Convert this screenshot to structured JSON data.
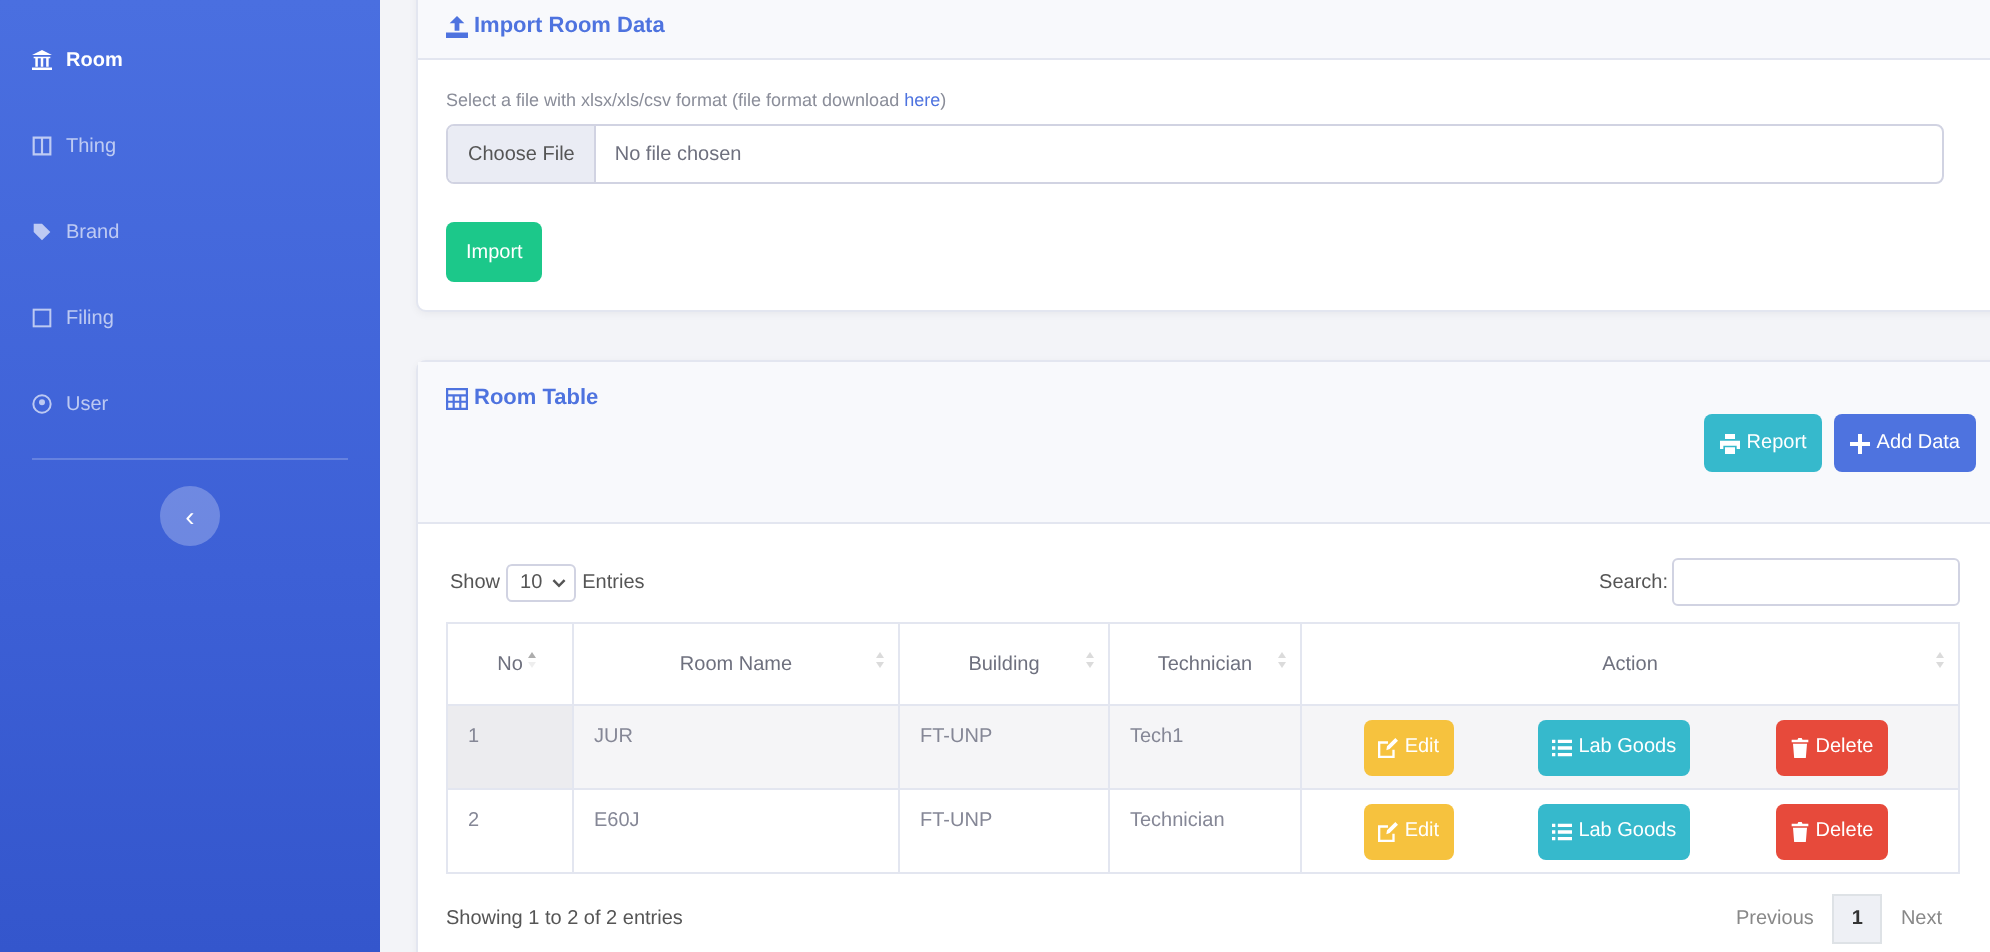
{
  "sidebar": {
    "items": [
      {
        "label": "Room",
        "selected": true
      },
      {
        "label": "Thing",
        "selected": false
      },
      {
        "label": "Brand",
        "selected": false
      },
      {
        "label": "Filing",
        "selected": false
      },
      {
        "label": "User",
        "selected": false
      }
    ],
    "toggle": "‹"
  },
  "import_card": {
    "title": "Import Room Data",
    "hint": {
      "before": "Select a file with xlsx/xls/csv format (file format download ",
      "link": "here",
      "after": ")"
    },
    "file_button": "Choose File",
    "file_status": "No file chosen",
    "submit": "Import"
  },
  "table_card": {
    "title": "Room Table",
    "buttons": [
      {
        "kind": "report",
        "label": "Report"
      },
      {
        "kind": "add",
        "label": "Add Data"
      }
    ],
    "show_label": "Show",
    "page_size": "10",
    "entries_label": "Entries",
    "search_label": "Search:",
    "columns": [
      {
        "label": "No",
        "sorted": true
      },
      {
        "label": "Room Name",
        "sorted": false
      },
      {
        "label": "Building",
        "sorted": false
      },
      {
        "label": "Technician",
        "sorted": false
      },
      {
        "label": "Action",
        "sorted": false
      }
    ],
    "rows": [
      {
        "cells": [
          "1",
          "JUR",
          "FT-UNP",
          "Tech1"
        ],
        "actions": [
          {
            "kind": "edit",
            "label": "Edit"
          },
          {
            "kind": "goods",
            "label": "Lab Goods"
          },
          {
            "kind": "delete",
            "label": "Delete"
          }
        ]
      },
      {
        "cells": [
          "2",
          "E60J",
          "FT-UNP",
          "Technician"
        ],
        "actions": [
          {
            "kind": "edit",
            "label": "Edit"
          },
          {
            "kind": "goods",
            "label": "Lab Goods"
          },
          {
            "kind": "delete",
            "label": "Delete"
          }
        ]
      }
    ],
    "info": "Showing 1 to 2 of 2 entries",
    "pagination": {
      "previous": "Previous",
      "pages": [
        {
          "label": "1",
          "selected": true
        }
      ],
      "next": "Next"
    }
  }
}
